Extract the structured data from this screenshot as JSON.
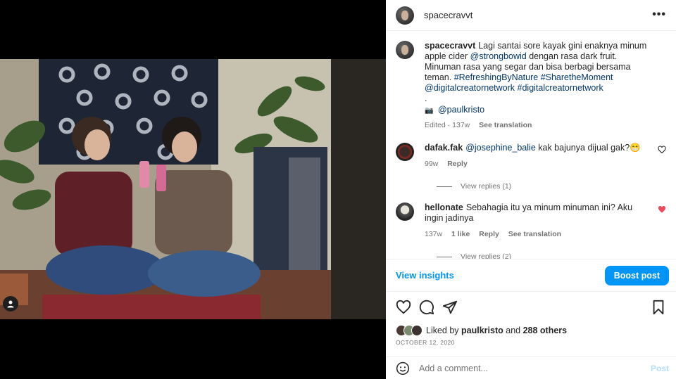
{
  "post": {
    "username": "spacecravvt",
    "more_icon": "more-horizontal-icon"
  },
  "caption": {
    "username": "spacecravvt",
    "text_1": "Lagi santai sore kayak gini enaknya minum apple cider ",
    "mention_1": "@strongbowid",
    "text_2": " dengan rasa dark fruit. Minuman rasa yang segar dan bisa berbagi bersama teman. ",
    "tag_1": "#RefreshingByNature",
    "tag_2": "#SharetheMoment",
    "mention_2": "@digitalcreatornetwork",
    "tag_3": "#digitalcreatornetwork",
    "dot": ".",
    "camera_emoji": "📷",
    "photo_credit": "@paulkristo",
    "edited": "Edited · 137w",
    "see_translation": "See translation"
  },
  "comments": [
    {
      "username": "dafak.fak",
      "mention": "@josephine_balie",
      "text": " kak bajunya dijual gak?",
      "emoji": "😁",
      "time": "99w",
      "reply": "Reply",
      "view_replies": "View replies (1)",
      "liked": false
    },
    {
      "username": "hellonate",
      "text": "Sebahagia itu ya minum minuman ini? Aku ingin jadinya",
      "time": "137w",
      "likes": "1 like",
      "reply": "Reply",
      "see_translation": "See translation",
      "view_replies": "View replies (2)",
      "liked": true
    }
  ],
  "insights": {
    "view_insights": "View insights",
    "boost_post": "Boost post"
  },
  "actions": {
    "icons": [
      "heart-icon",
      "comment-icon",
      "share-icon",
      "bookmark-icon"
    ]
  },
  "likes": {
    "prefix": "Liked by ",
    "user": "paulkristo",
    "middle": " and ",
    "others": "288 others"
  },
  "date": "OCTOBER 12, 2020",
  "add_comment": {
    "placeholder": "Add a comment...",
    "post_label": "Post"
  },
  "colors": {
    "accent": "#0095f6",
    "link": "#00376b",
    "like_red": "#ed4956",
    "muted": "#737373"
  }
}
